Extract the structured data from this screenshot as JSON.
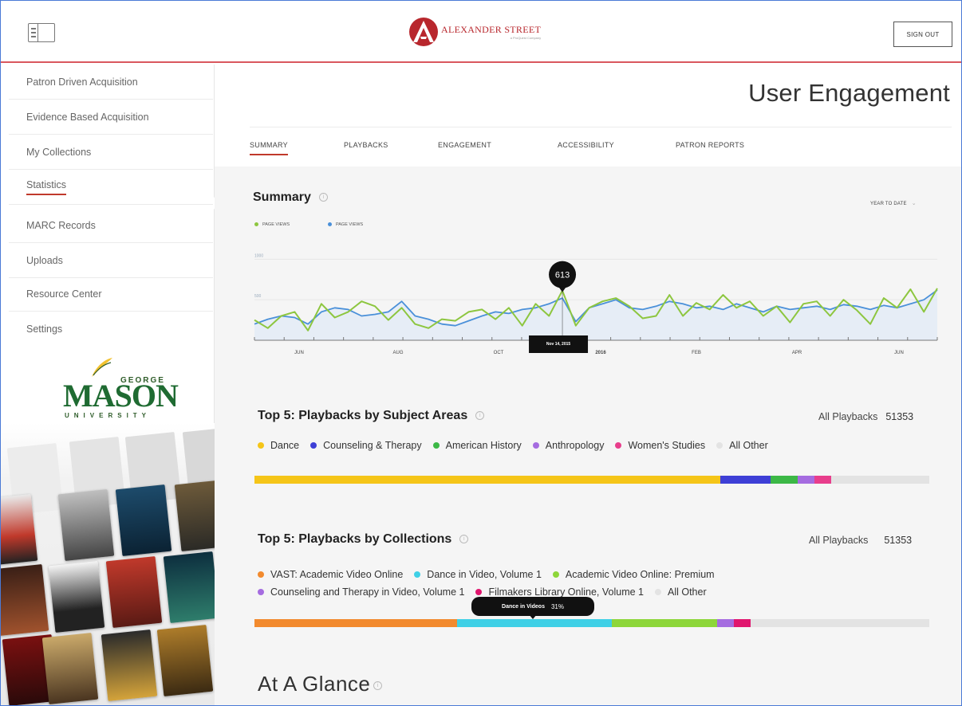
{
  "header": {
    "brand_name": "ALEXANDER STREET",
    "brand_sub": "a ProQuest Company",
    "signout_label": "SIGN OUT"
  },
  "sidebar": {
    "items": [
      {
        "label": "Patron Driven Acquisition"
      },
      {
        "label": "Evidence Based Acquisition"
      },
      {
        "label": "My Collections"
      },
      {
        "label": "Statistics",
        "active": true
      },
      {
        "label": "MARC Records"
      },
      {
        "label": "Uploads"
      },
      {
        "label": "Resource Center"
      },
      {
        "label": "Settings"
      }
    ],
    "institution": {
      "line1": "GEORGE",
      "line2": "MASON",
      "line3": "UNIVERSITY"
    }
  },
  "page": {
    "title": "User Engagement",
    "tabs": [
      {
        "label": "SUMMARY",
        "active": true
      },
      {
        "label": "PLAYBACKS"
      },
      {
        "label": "ENGAGEMENT"
      },
      {
        "label": "ACCESSIBILITY"
      },
      {
        "label": "PATRON REPORTS"
      }
    ]
  },
  "summary": {
    "title": "Summary",
    "range": "YEAR TO DATE",
    "legend": [
      {
        "label": "PAGE VIEWS",
        "color": "#8dc63f"
      },
      {
        "label": "PAGE VIEWS",
        "color": "#4a90d9"
      }
    ],
    "tooltip_value": "613",
    "tooltip_date": "Nov 14, 2015"
  },
  "chart_data": {
    "type": "line",
    "x_tick_labels": [
      "JUN",
      "AUG",
      "OCT",
      "2016",
      "FEB",
      "APR",
      "JUN"
    ],
    "y_tick_labels": [
      "1000",
      "500"
    ],
    "ylim": [
      0,
      1200
    ],
    "series": [
      {
        "name": "PAGE VIEWS",
        "color": "#8dc63f",
        "values": [
          250,
          150,
          300,
          350,
          120,
          450,
          280,
          350,
          480,
          420,
          250,
          400,
          200,
          150,
          260,
          240,
          350,
          380,
          260,
          400,
          180,
          450,
          300,
          613,
          180,
          400,
          480,
          520,
          420,
          270,
          300,
          560,
          300,
          460,
          380,
          560,
          400,
          480,
          300,
          420,
          220,
          450,
          480,
          300,
          500,
          370,
          200,
          520,
          400,
          630,
          350,
          640
        ]
      },
      {
        "name": "PAGE VIEWS",
        "color": "#4a90d9",
        "values": [
          200,
          260,
          300,
          280,
          200,
          350,
          400,
          380,
          300,
          320,
          350,
          480,
          300,
          260,
          200,
          180,
          240,
          300,
          350,
          330,
          380,
          400,
          450,
          520,
          230,
          400,
          450,
          500,
          400,
          380,
          420,
          480,
          450,
          400,
          420,
          380,
          450,
          400,
          350,
          420,
          380,
          400,
          420,
          380,
          440,
          420,
          380,
          430,
          400,
          450,
          500,
          620
        ]
      }
    ]
  },
  "subjects": {
    "title": "Top 5: Playbacks by Subject Areas",
    "total_label": "All Playbacks",
    "total_value": "51353",
    "items": [
      {
        "label": "Dance",
        "color": "#f5c518",
        "share": 69
      },
      {
        "label": "Counseling & Therapy",
        "color": "#3e3fd6",
        "share": 7.5
      },
      {
        "label": "American History",
        "color": "#3cb846",
        "share": 4
      },
      {
        "label": "Anthropology",
        "color": "#a56ce0",
        "share": 2.5
      },
      {
        "label": "Women's Studies",
        "color": "#e83e8c",
        "share": 2.5
      },
      {
        "label": "All Other",
        "color": "#e3e3e3",
        "share": 14.5
      }
    ]
  },
  "collections": {
    "title": "Top 5: Playbacks by Collections",
    "total_label": "All Playbacks",
    "total_value": "51353",
    "items": [
      {
        "label": "VAST: Academic Video Online",
        "color": "#f28a2e",
        "share": 30
      },
      {
        "label": "Dance in Video, Volume 1",
        "color": "#3fd0e6",
        "share": 23
      },
      {
        "label": "Academic Video Online: Premium",
        "color": "#8dd63a",
        "share": 15.5
      },
      {
        "label": "Counseling and Therapy in Video, Volume 1",
        "color": "#a56ce0",
        "share": 2.5
      },
      {
        "label": "Filmakers Library Online, Volume 1",
        "color": "#e0166e",
        "share": 2.5
      },
      {
        "label": "All Other",
        "color": "#e3e3e3",
        "share": 26.5
      }
    ],
    "tooltip_label": "Dance in Videos",
    "tooltip_value": "31%"
  },
  "glance": {
    "title": "At A Glance"
  }
}
